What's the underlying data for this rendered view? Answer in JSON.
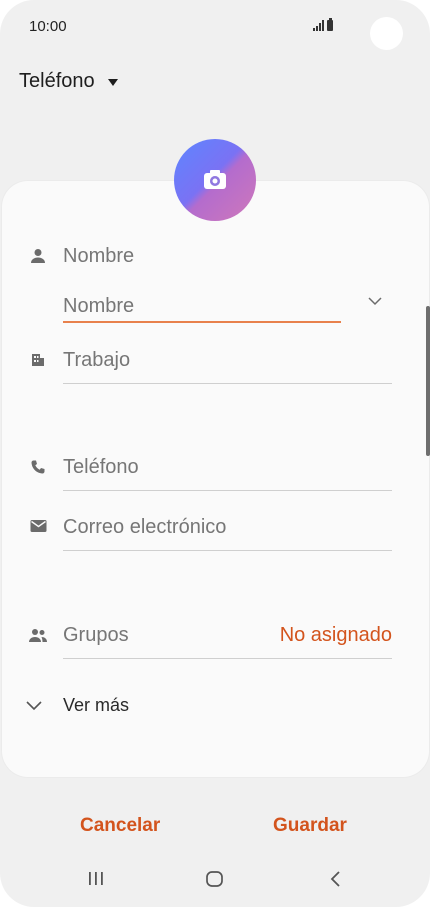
{
  "status_bar": {
    "time": "10:00"
  },
  "header": {
    "account": "Teléfono"
  },
  "form": {
    "name_label": "Nombre",
    "name_placeholder": "Nombre",
    "company_label": "Trabajo",
    "phone_label": "Teléfono",
    "email_label": "Correo electrónico",
    "groups_label": "Grupos",
    "groups_value": "No asignado",
    "more_label": "Ver más"
  },
  "actions": {
    "cancel": "Cancelar",
    "save": "Guardar"
  },
  "icons": {
    "photo": "camera-icon",
    "name": "person-icon",
    "company": "building-icon",
    "phone": "phone-icon",
    "email": "mail-icon",
    "groups": "group-icon",
    "more": "chevron-down-icon"
  },
  "colors": {
    "accent": "#d3541d",
    "focus_underline": "#e8814c",
    "background": "#f0f0f0",
    "card": "#fafafa"
  }
}
